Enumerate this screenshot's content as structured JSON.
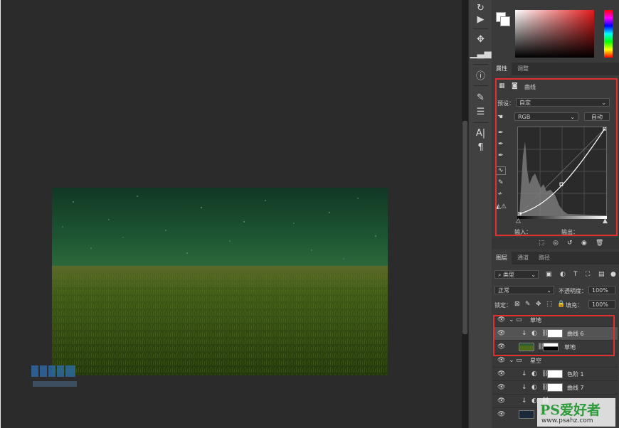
{
  "properties_tabs": [
    "属性",
    "调整"
  ],
  "properties": {
    "title": "曲线",
    "preset_label": "预设：",
    "preset_value": "自定",
    "channel_value": "RGB",
    "auto_button": "自动",
    "input_label": "输入：",
    "output_label": "输出："
  },
  "layers_tabs": [
    "图层",
    "通道",
    "路径"
  ],
  "layers_panel": {
    "filter_label": "类型",
    "blend_mode": "正常",
    "opacity_label": "不透明度：",
    "opacity_value": "100%",
    "lock_label": "锁定：",
    "fill_label": "填充：",
    "fill_value": "100%"
  },
  "layers": [
    {
      "name": "草地",
      "type": "group"
    },
    {
      "name": "曲线 6",
      "type": "adjustment"
    },
    {
      "name": "草地",
      "type": "image"
    },
    {
      "name": "星空",
      "type": "group"
    },
    {
      "name": "色阶 1",
      "type": "adjustment"
    },
    {
      "name": "曲线 7",
      "type": "adjustment"
    },
    {
      "name": "",
      "type": "adjustment"
    },
    {
      "name": "",
      "type": "image"
    }
  ],
  "watermarks": {
    "site_brand": "PS爱好者",
    "site_url": "www.psahz.com",
    "logo_text": "UIBQ"
  },
  "colors": {
    "highlight": "#e0312f",
    "sky": "#1b4a30",
    "grass": "#3a5a1a"
  }
}
